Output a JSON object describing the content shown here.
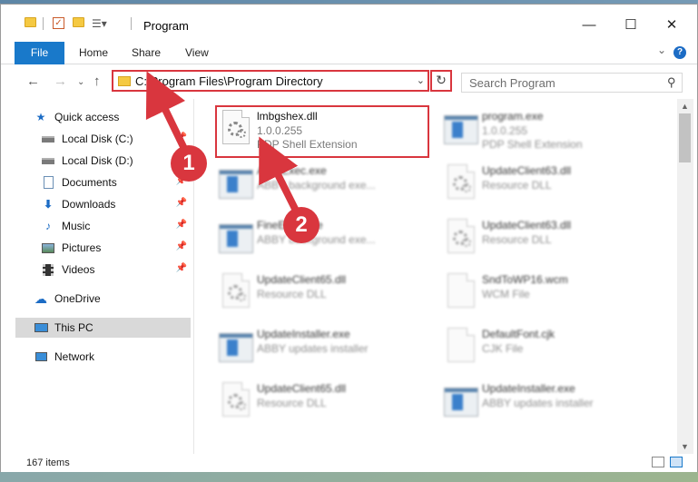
{
  "window": {
    "title": "Program",
    "controls": {
      "minimize": "—",
      "maximize": "☐",
      "close": "✕"
    }
  },
  "ribbon": {
    "file": "File",
    "home": "Home",
    "share": "Share",
    "view": "View"
  },
  "nav": {
    "address": "C:\\Program Files\\Program Directory",
    "search_placeholder": "Search Program"
  },
  "sidebar": {
    "items": [
      {
        "label": "Quick access",
        "icon": "star-icon"
      },
      {
        "label": "Local Disk (C:)",
        "icon": "drive-icon"
      },
      {
        "label": "Local Disk (D:)",
        "icon": "drive-icon"
      },
      {
        "label": "Documents",
        "icon": "documents-icon"
      },
      {
        "label": "Downloads",
        "icon": "download-icon"
      },
      {
        "label": "Music",
        "icon": "music-icon"
      },
      {
        "label": "Pictures",
        "icon": "pictures-icon"
      },
      {
        "label": "Videos",
        "icon": "videos-icon"
      },
      {
        "label": "OneDrive",
        "icon": "cloud-icon"
      },
      {
        "label": "This PC",
        "icon": "computer-icon"
      },
      {
        "label": "Network",
        "icon": "network-icon"
      }
    ]
  },
  "files": [
    {
      "name": "lmbgshex.dll",
      "line2": "1.0.0.255",
      "line3": "PDP Shell Extension",
      "type": "dll"
    },
    {
      "name": "program.exe",
      "line2": "1.0.0.255",
      "line3": "PDP Shell Extension",
      "type": "exe"
    },
    {
      "name": "AbbyExec.exe",
      "line2": "ABBY background exe...",
      "line3": "",
      "type": "app"
    },
    {
      "name": "UpdateClient63.dll",
      "line2": "Resource DLL",
      "line3": "",
      "type": "dll"
    },
    {
      "name": "FineExec.exe",
      "line2": "ABBY background exe...",
      "line3": "",
      "type": "app"
    },
    {
      "name": "UpdateClient63.dll",
      "line2": "Resource DLL",
      "line3": "",
      "type": "dll"
    },
    {
      "name": "UpdateClient65.dll",
      "line2": "Resource DLL",
      "line3": "",
      "type": "dll"
    },
    {
      "name": "SndToWP16.wcm",
      "line2": "WCM File",
      "line3": "",
      "type": "blank"
    },
    {
      "name": "UpdateInstaller.exe",
      "line2": "ABBY updates installer",
      "line3": "",
      "type": "app"
    },
    {
      "name": "DefaultFont.cjk",
      "line2": "CJK File",
      "line3": "",
      "type": "blank"
    },
    {
      "name": "UpdateClient65.dll",
      "line2": "Resource DLL",
      "line3": "",
      "type": "dll"
    },
    {
      "name": "UpdateInstaller.exe",
      "line2": "ABBY updates installer",
      "line3": "",
      "type": "app"
    }
  ],
  "status": {
    "count": "167 items"
  },
  "annotations": {
    "step1": "1",
    "step2": "2"
  },
  "colors": {
    "accent": "#1979ca",
    "highlight": "#d9363e"
  }
}
